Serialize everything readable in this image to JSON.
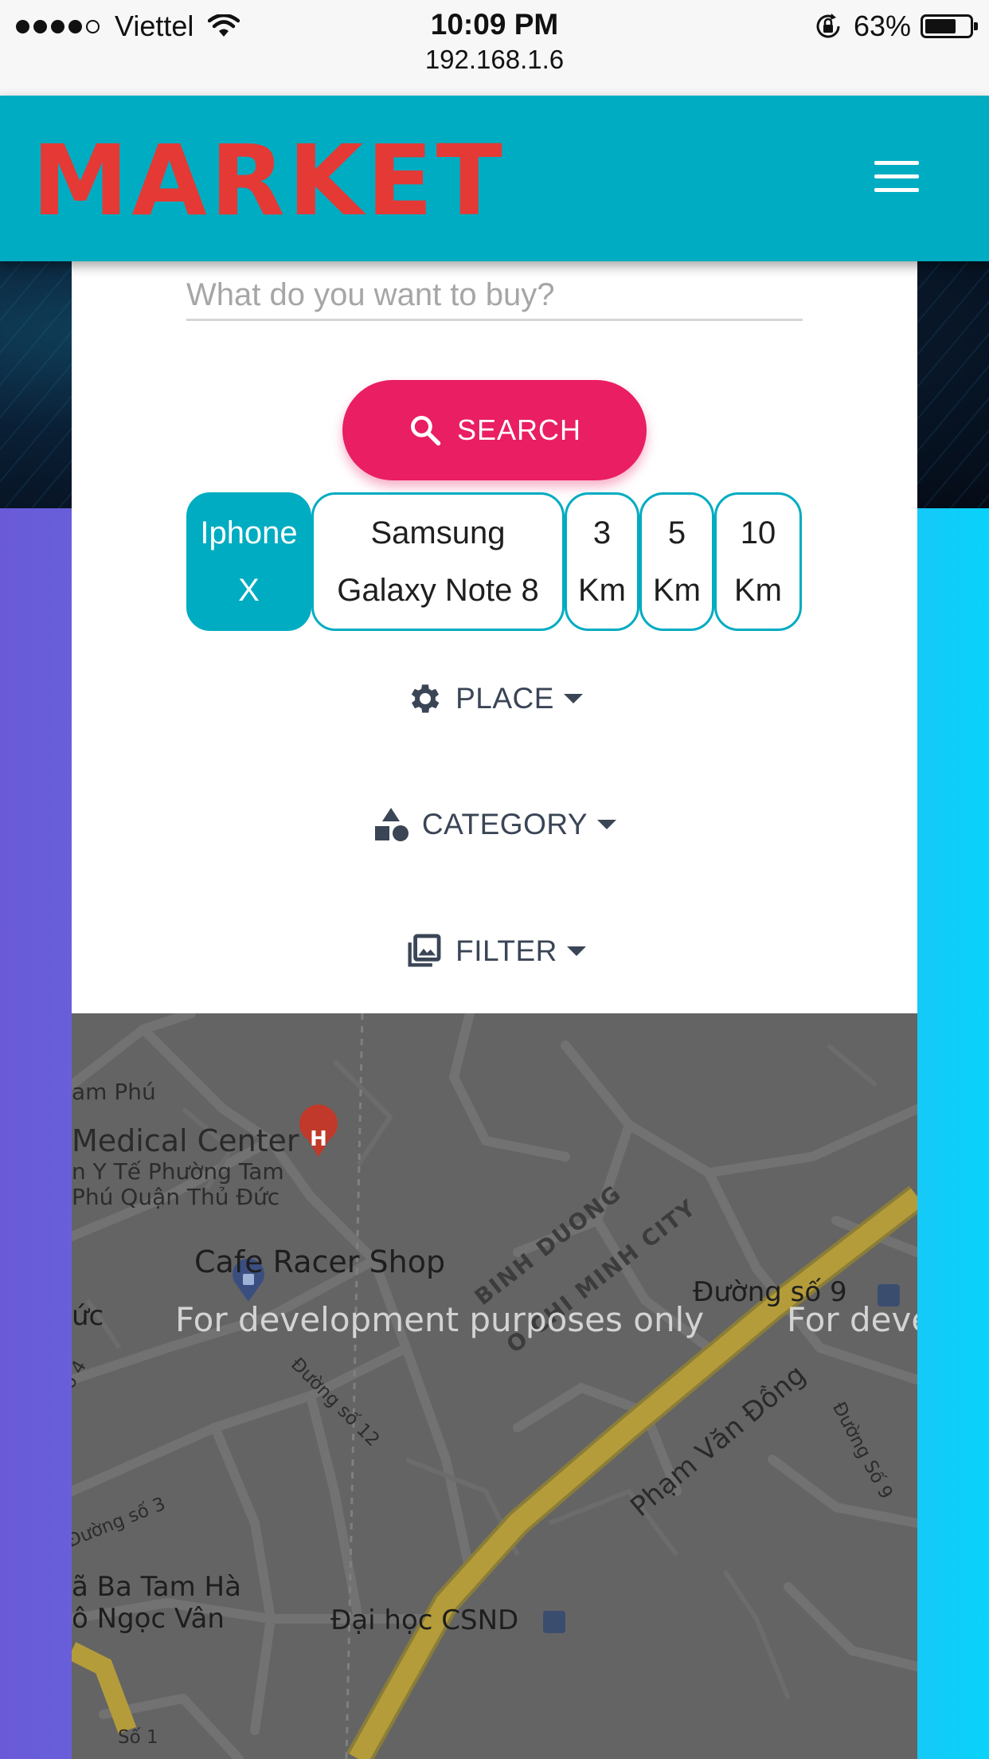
{
  "status_bar": {
    "carrier": "Viettel",
    "time": "10:09 PM",
    "url": "192.168.1.6",
    "battery": "63%",
    "battery_level": 0.63,
    "signal_dots_filled": 4,
    "signal_dots_total": 5
  },
  "header": {
    "brand": "MARKET",
    "menu_icon": "hamburger-menu-icon",
    "background_color": "#00acc1",
    "brand_color": "#e53935"
  },
  "search": {
    "placeholder": "What do you want to buy?",
    "button_label": "SEARCH",
    "button_icon": "search-icon",
    "button_color": "#e91e63"
  },
  "chips": [
    {
      "line1": "Iphone",
      "line2": "X",
      "active": true
    },
    {
      "line1": "Samsung",
      "line2": "Galaxy Note 8",
      "active": false
    },
    {
      "line1": "3",
      "line2": "Km",
      "active": false
    },
    {
      "line1": "5",
      "line2": "Km",
      "active": false
    },
    {
      "line1": "10",
      "line2": "Km",
      "active": false
    }
  ],
  "dropdowns": {
    "place": {
      "label": "PLACE",
      "icon": "gear-icon"
    },
    "category": {
      "label": "CATEGORY",
      "icon": "shapes-icon"
    },
    "filter": {
      "label": "FILTER",
      "icon": "photo-library-icon"
    }
  },
  "map": {
    "watermark": "For development purposes only",
    "watermark_partial": "For deve",
    "labels": {
      "tam_phu": "am Phú",
      "medical_center": "Medical Center",
      "medical_sub1": "n Y Tế Phường Tam",
      "medical_sub2": "Phú Quận Thủ Đức",
      "cafe": "Cafe Racer Shop",
      "binh_duong": "BINH DUONG",
      "hcm": "O CHI MINH CITY",
      "duong_so_9": "Đường số 9",
      "uc": "ức",
      "so_4": "số 4",
      "duong_so_12": "Đường số 12",
      "pham_van_dong": "Phạm Văn Đồng",
      "duong_so_9_vertical": "Đường Số 9",
      "duong_so_3": "Đường số 3",
      "nga_ba_tam_ha": "ã Ba Tam Hà",
      "ngoc_van": "ô Ngọc Vân",
      "dai_hoc": "Đại học CSND",
      "so_1": "Số 1"
    }
  }
}
